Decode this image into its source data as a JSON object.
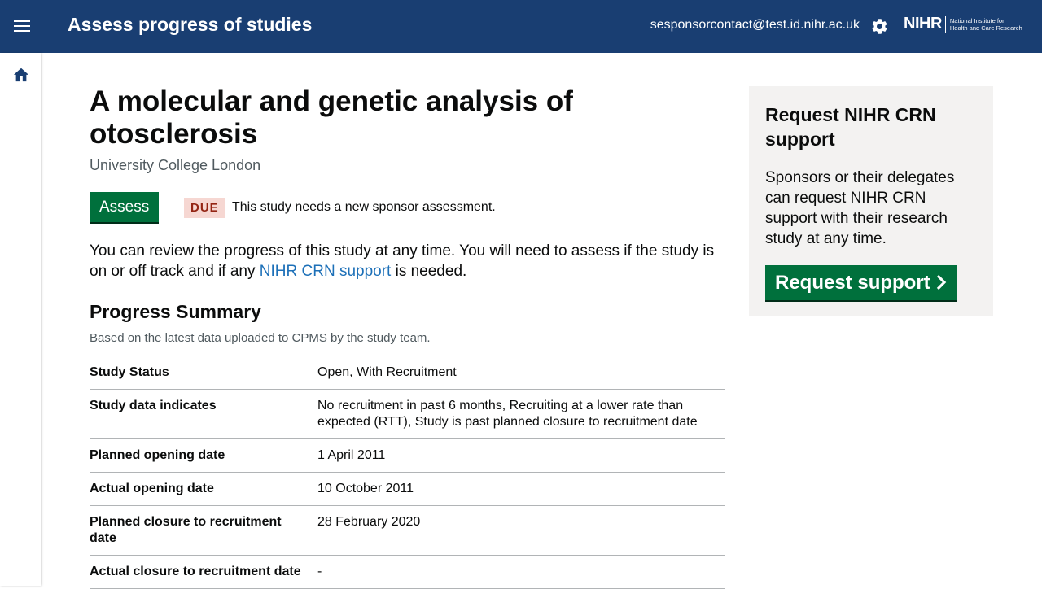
{
  "header": {
    "title": "Assess progress of studies",
    "user_email": "sesponsorcontact@test.id.nihr.ac.uk",
    "logo": {
      "main": "NIHR",
      "sub_line1": "National Institute for",
      "sub_line2": "Health and Care Research"
    }
  },
  "study": {
    "title": "A molecular and genetic analysis of otosclerosis",
    "organisation": "University College London",
    "assess_label": "Assess",
    "due_tag": "DUE",
    "due_message": "This study needs a new sponsor assessment.",
    "intro_before": "You can review the progress of this study at any time. You will need to assess if the study is on or off track and if any ",
    "intro_link": "NIHR CRN support",
    "intro_after": " is needed."
  },
  "progress": {
    "heading": "Progress Summary",
    "subheading": "Based on the latest data uploaded to CPMS by the study team.",
    "rows": [
      {
        "key": "Study Status",
        "value": "Open, With Recruitment"
      },
      {
        "key": "Study data indicates",
        "value": "No recruitment in past 6 months, Recruiting at a lower rate than expected (RTT), Study is past planned closure to recruitment date"
      },
      {
        "key": "Planned opening date",
        "value": "1 April 2011"
      },
      {
        "key": "Actual opening date",
        "value": "10 October 2011"
      },
      {
        "key": "Planned closure to recruitment date",
        "value": "28 February 2020"
      },
      {
        "key": "Actual closure to recruitment date",
        "value": "-"
      }
    ]
  },
  "support_panel": {
    "title": "Request NIHR CRN support",
    "text": "Sponsors or their delegates can request NIHR CRN support with their research study at any time.",
    "button_label": "Request support"
  },
  "icons": {
    "menu": "menu-icon",
    "settings": "gear-icon",
    "home": "home-icon",
    "chevron": "chevron-right-icon"
  },
  "colors": {
    "header_bg": "#193e72",
    "primary_button": "#00703c",
    "link": "#1d70b8",
    "due_tag_bg": "#f6d7d2",
    "due_tag_text": "#942514",
    "panel_bg": "#f3f2f1"
  }
}
